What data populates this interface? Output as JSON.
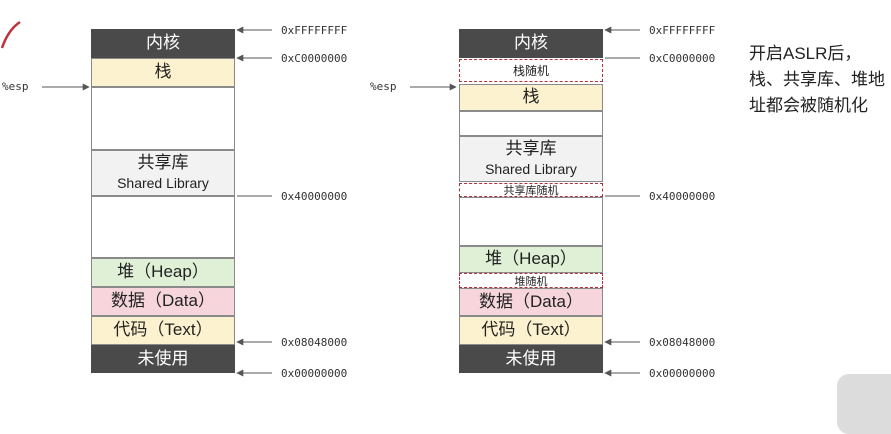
{
  "left_diagram": {
    "kernel": "内核",
    "stack": "栈",
    "shared_lib_cn": "共享库",
    "shared_lib_en": "Shared Library",
    "heap": "堆（Heap）",
    "data": "数据（Data）",
    "text": "代码（Text）",
    "unused": "未使用",
    "esp": "%esp"
  },
  "right_diagram": {
    "kernel": "内核",
    "stack_random": "栈随机",
    "stack": "栈",
    "shared_lib_cn": "共享库",
    "shared_lib_en": "Shared Library",
    "lib_random": "共享库随机",
    "heap": "堆（Heap）",
    "heap_random": "堆随机",
    "data": "数据（Data）",
    "text": "代码（Text）",
    "unused": "未使用",
    "esp": "%esp"
  },
  "addresses": {
    "top": "0xFFFFFFFF",
    "kernel_base": "0xC0000000",
    "lib_base": "0x40000000",
    "text_base": "0x08048000",
    "zero": "0x00000000"
  },
  "note": "开启ASLR后，栈、共享库、堆地址都会被随机化",
  "colors": {
    "kernel": "#4a4a4a",
    "stack": "#fdf2cf",
    "shared_library": "#f2f2f2",
    "heap": "#dff0d6",
    "data": "#f6d6dc",
    "text": "#fdf2cf",
    "random_border": "#b0303a"
  }
}
